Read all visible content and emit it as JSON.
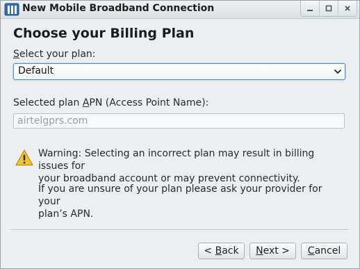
{
  "window": {
    "title": "New Mobile Broadband Connection",
    "controls": {
      "minimize_icon": "minimize-icon",
      "maximize_icon": "maximize-icon",
      "close_icon": "close-icon"
    }
  },
  "page": {
    "heading": "Choose your Billing Plan",
    "plan_label": {
      "accel": "S",
      "rest": "elect your plan:"
    },
    "plan_select": {
      "selected": "Default"
    },
    "apn_label": {
      "before": "Selected plan ",
      "accel": "A",
      "after": "PN (Access Point Name):"
    },
    "apn_value": "airtelgprs.com",
    "warning_icon": "warning-icon",
    "warning_lines": [
      "Warning: Selecting an incorrect plan may result in billing issues for",
      "your broadband account or may prevent connectivity."
    ],
    "hint_lines": [
      "If you are unsure of your plan please ask your provider for your",
      "plan’s APN."
    ]
  },
  "buttons": {
    "back": {
      "prefix": "< ",
      "accel": "B",
      "rest": "ack"
    },
    "next": {
      "accel": "N",
      "rest": "ext >"
    },
    "cancel": {
      "accel": "C",
      "rest": "ancel"
    }
  },
  "colors": {
    "focus_border": "#5b8fc9",
    "warning_fill": "#f2c230",
    "window_bg": "#eceff1"
  }
}
